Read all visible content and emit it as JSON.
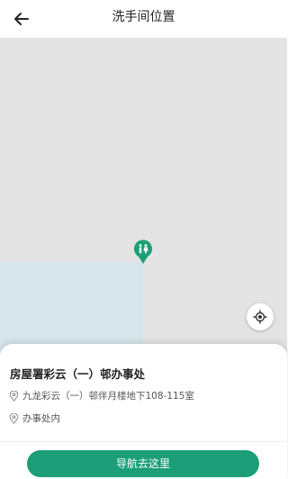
{
  "header": {
    "title": "洗手间位置",
    "back_icon": "arrow-left-icon"
  },
  "map": {
    "background_color": "#e3e3e3",
    "building_color": "#d5e5ea",
    "marker_icon": "restroom-marker-icon",
    "marker_color": "#1c9e78",
    "locate_icon": "crosshair-locate-icon"
  },
  "place": {
    "name": "房屋署彩云（一）邨办事处",
    "address": "九龙彩云（一）邨伴月楼地下108-115室",
    "note": "办事处内",
    "pin_icon": "location-pin-icon"
  },
  "actions": {
    "navigate_label": "导航去这里",
    "accent_color": "#1c9e78"
  }
}
